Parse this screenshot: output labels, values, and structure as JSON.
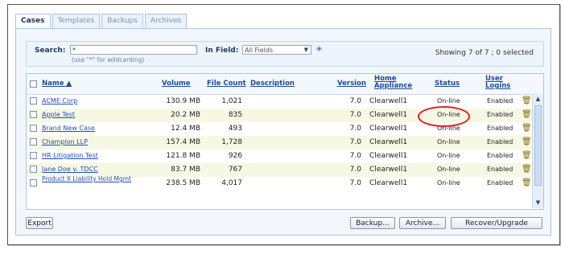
{
  "tabs": [
    "Cases",
    "Templates",
    "Backups",
    "Archives"
  ],
  "search": {
    "label": "Search:",
    "value": "*",
    "hint": "(use \"*\" for wildcarding)",
    "in_field_label": "In Field:",
    "in_field_value": "All Fields",
    "showing": "Showing 7 of 7 ; 0 selected"
  },
  "columns": {
    "name": "Name ▲",
    "volume": "Volume",
    "file_count": "File Count",
    "description": "Description",
    "version": "Version",
    "home_appliance": "Home Appliance",
    "status": "Status",
    "user_logins": "User Logins"
  },
  "rows": [
    {
      "name": "ACME Corp",
      "volume": "130.9 MB",
      "file_count": "1,021",
      "description": "",
      "version": "7.0",
      "home_appliance": "Clearwell1",
      "status": "On-line",
      "user_logins": "Enabled"
    },
    {
      "name": "Apple Test",
      "volume": "20.2 MB",
      "file_count": "835",
      "description": "",
      "version": "7.0",
      "home_appliance": "Clearwell1",
      "status": "On-line",
      "user_logins": "Enabled"
    },
    {
      "name": "Brand New Case",
      "volume": "12.4 MB",
      "file_count": "493",
      "description": "",
      "version": "7.0",
      "home_appliance": "Clearwell1",
      "status": "On-line",
      "user_logins": "Enabled"
    },
    {
      "name": "Champion LLP",
      "volume": "157.4 MB",
      "file_count": "1,728",
      "description": "",
      "version": "7.0",
      "home_appliance": "Clearwell1",
      "status": "On-line",
      "user_logins": "Enabled"
    },
    {
      "name": "HR Litigation Test",
      "volume": "121.8 MB",
      "file_count": "926",
      "description": "",
      "version": "7.0",
      "home_appliance": "Clearwell1",
      "status": "On-line",
      "user_logins": "Enabled"
    },
    {
      "name": "Jane Doe v. TDCC",
      "volume": "83.7 MB",
      "file_count": "767",
      "description": "",
      "version": "7.0",
      "home_appliance": "Clearwell1",
      "status": "On-line",
      "user_logins": "Enabled"
    },
    {
      "name": "Product X Liability Hold Mgmt",
      "volume": "238.5 MB",
      "file_count": "4,017",
      "description": "",
      "version": "7.0",
      "home_appliance": "Clearwell1",
      "status": "On-line",
      "user_logins": "Enabled"
    }
  ],
  "buttons": {
    "export": "Export",
    "backup": "Backup...",
    "archive": "Archive...",
    "recover": "Recover/Upgrade"
  },
  "colors": {
    "annotation_circle": "#e02020",
    "row_highlight": "#f6f8e4",
    "link": "#1f4fb5"
  },
  "icons": [
    "trash-icon",
    "dropdown-arrow-icon",
    "info-diamond-icon",
    "sort-up-icon"
  ]
}
